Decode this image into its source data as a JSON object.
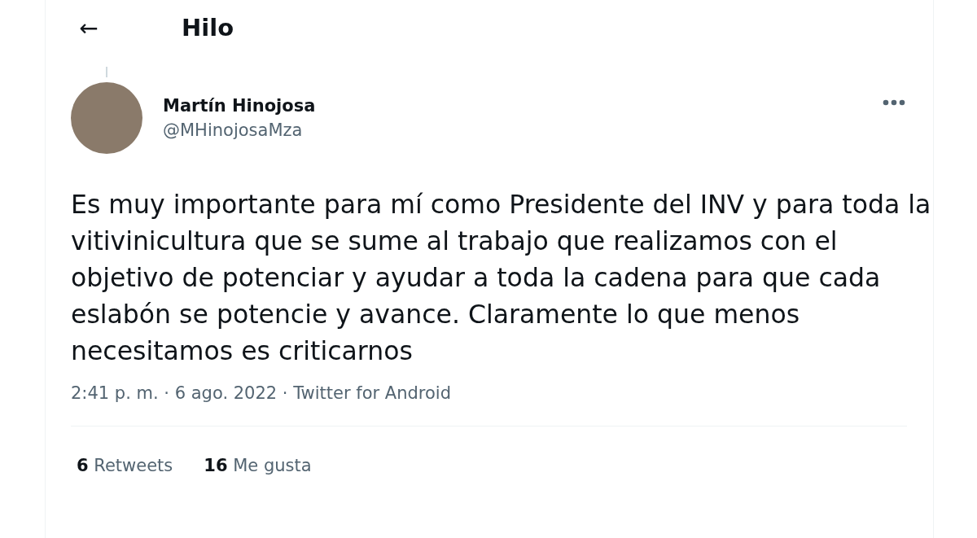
{
  "header": {
    "back": "←",
    "title": "Hilo"
  },
  "tweet": {
    "author": {
      "name": "Martín Hinojosa",
      "handle": "@MHinojosaMza"
    },
    "text": "Es muy importante para mí como Presidente del INV y para toda la vitivinicultura que se sume al trabajo que realizamos con el objetivo de potenciar y ayudar a toda la cadena para que cada eslabón se potencie y avance. Claramente lo que menos necesitamos es criticarnos",
    "meta": "2:41 p. m. · 6 ago. 2022 · Twitter for Android",
    "stats": [
      {
        "count": "6",
        "label": "Retweets"
      },
      {
        "count": "16",
        "label": "Me gusta"
      }
    ]
  }
}
